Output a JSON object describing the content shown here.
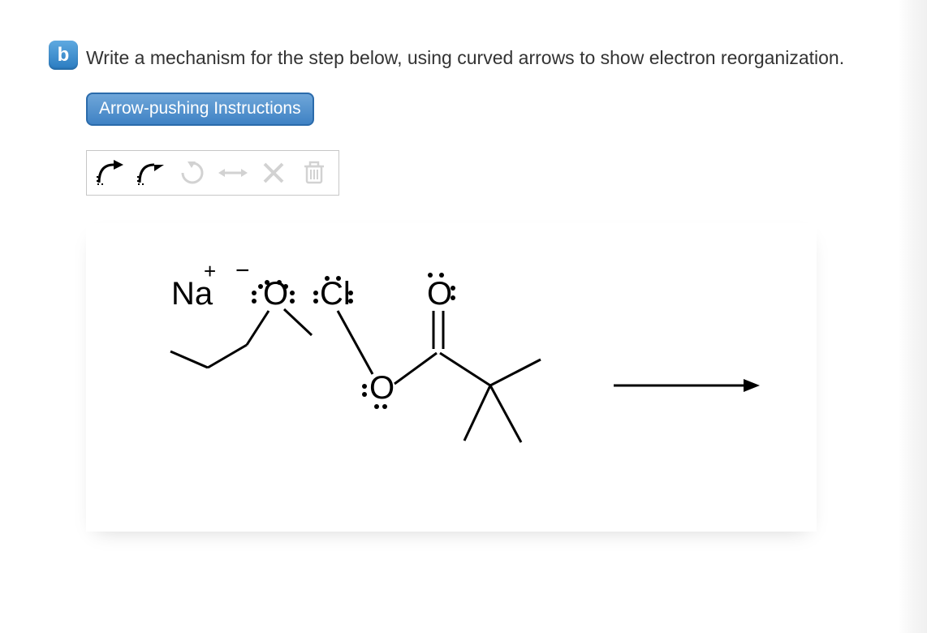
{
  "question": {
    "part_label": "b",
    "prompt": "Write a mechanism for the step below, using curved arrows to show electron reorganization."
  },
  "buttons": {
    "instructions": "Arrow-pushing Instructions"
  },
  "toolbar": {
    "full_arrow": "full-curved-arrow",
    "half_arrow": "half-curved-arrow",
    "rotate": "rotate",
    "move": "move",
    "delete_one": "delete-arrow",
    "delete_all": "delete-all"
  },
  "molecule": {
    "cation_label": "Na",
    "cation_charge": "+",
    "anion_charge": "−",
    "anion_label": "O",
    "cl_label": "Cl",
    "carbonyl_o": "O",
    "ester_o": "O"
  }
}
